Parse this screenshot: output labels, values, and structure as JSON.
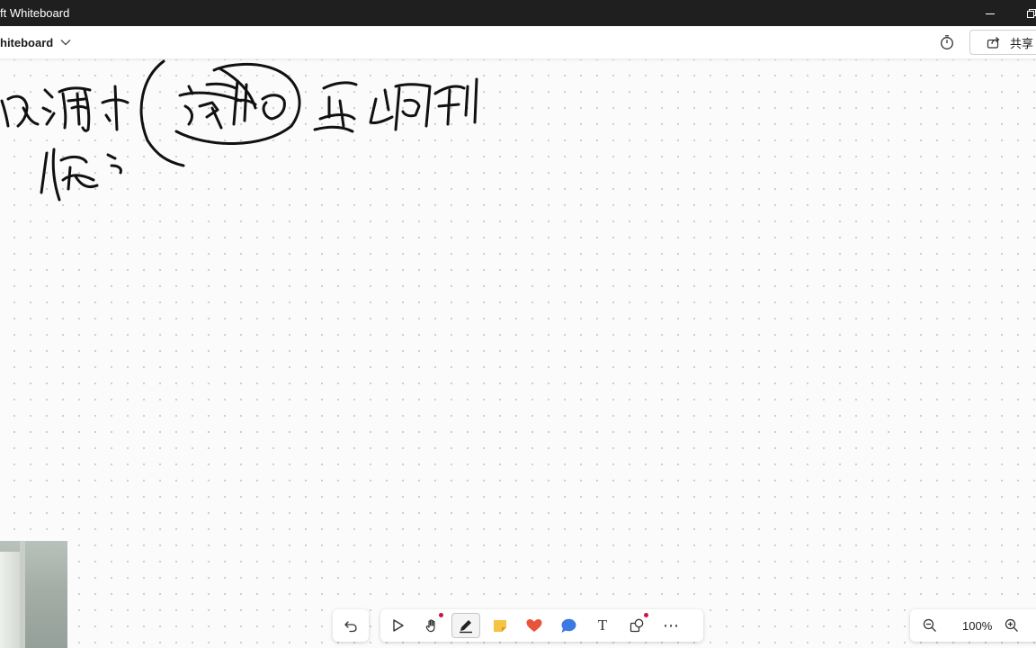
{
  "window": {
    "title": "ft Whiteboard",
    "controls": [
      "minimize-icon",
      "restore-icon"
    ]
  },
  "header": {
    "board_name": "hiteboard",
    "share_label": "共享"
  },
  "canvas": {
    "dot_grid": true,
    "handwriting_text": "在调寸 字母以上面 怎么回到 你的"
  },
  "toolbar": {
    "tools": [
      "undo-icon",
      "select-icon",
      "hand-icon",
      "pen-icon",
      "sticky-note-icon",
      "heart-icon",
      "comment-icon",
      "text-icon",
      "shapes-icon",
      "more-icon"
    ],
    "active_tool": "pen-icon",
    "text_tool_glyph": "T",
    "more_glyph": "⋯"
  },
  "zoom": {
    "level": "100%"
  },
  "colors": {
    "titlebar": "#1f1f1f",
    "accent_dot": "#d1103f",
    "sticky": "#f6c343",
    "heart": "#e8543a",
    "comment": "#3b7ae3"
  }
}
